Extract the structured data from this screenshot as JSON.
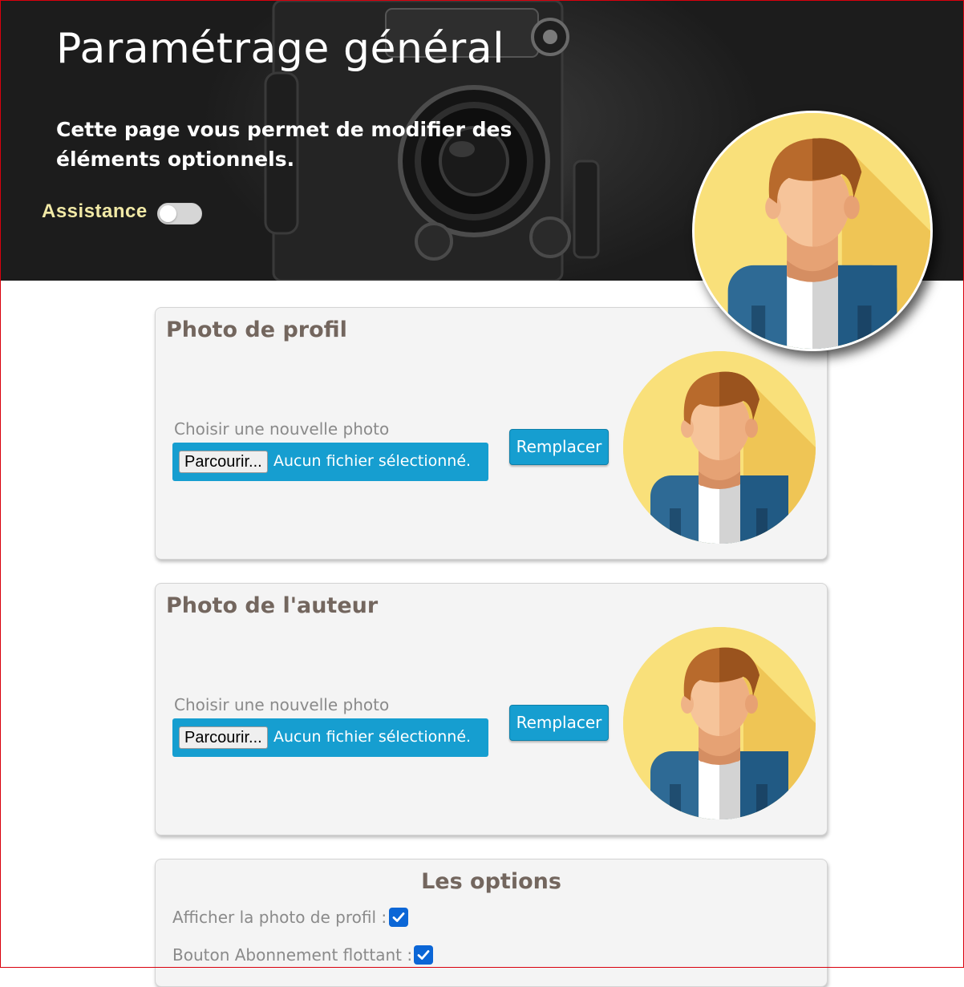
{
  "header": {
    "title": "Paramétrage général",
    "subtitle": "Cette page vous permet de modifier des éléments optionnels.",
    "assistance_label": "Assistance",
    "assistance_enabled": false
  },
  "sections": [
    {
      "title": "Photo de profil",
      "file_label": "Choisir une nouvelle photo",
      "browse_label": "Parcourir...",
      "file_status": "Aucun fichier sélectionné.",
      "replace_label": "Remplacer"
    },
    {
      "title": "Photo de l'auteur",
      "file_label": "Choisir une nouvelle photo",
      "browse_label": "Parcourir...",
      "file_status": "Aucun fichier sélectionné.",
      "replace_label": "Remplacer"
    }
  ],
  "options": {
    "title": "Les options",
    "items": [
      {
        "label": "Afficher la photo de profil :",
        "checked": true
      },
      {
        "label": "Bouton Abonnement flottant :",
        "checked": true
      }
    ]
  },
  "colors": {
    "accent": "#169ed0",
    "checkbox": "#0b66d6",
    "section_title": "#73665e",
    "assistance_label": "#f1e9a6"
  }
}
